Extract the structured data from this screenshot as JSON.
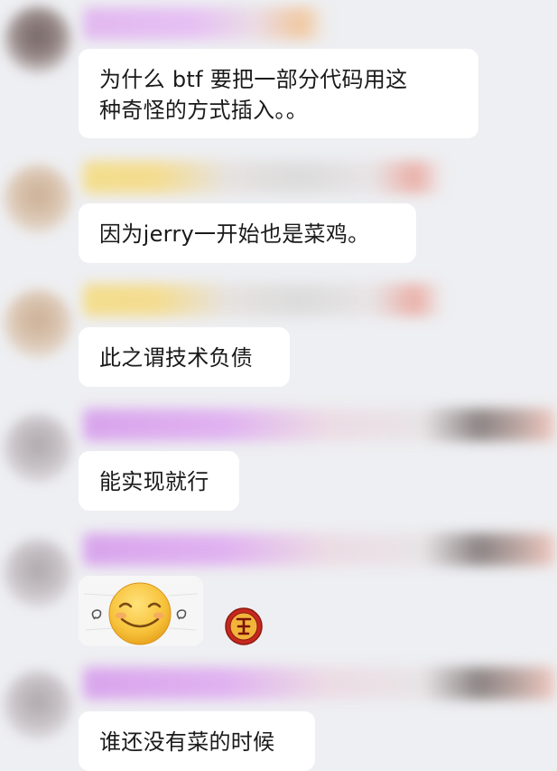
{
  "messages": [
    {
      "text": "为什么 btf 要把一部分代码用这\n种奇怪的方式插入。。"
    },
    {
      "text": "因为jerry一开始也是菜鸡。"
    },
    {
      "text": "此之谓技术负债"
    },
    {
      "text": "能实现就行"
    },
    {
      "text": "谁还没有菜的时候"
    }
  ],
  "sticker": {
    "icon": "smiley-face-sticker"
  },
  "reaction": {
    "icon": "red-round-badge-icon"
  },
  "colors": {
    "background": "#eeeff2",
    "bubble": "#ffffff",
    "text": "#1a1a1a"
  }
}
